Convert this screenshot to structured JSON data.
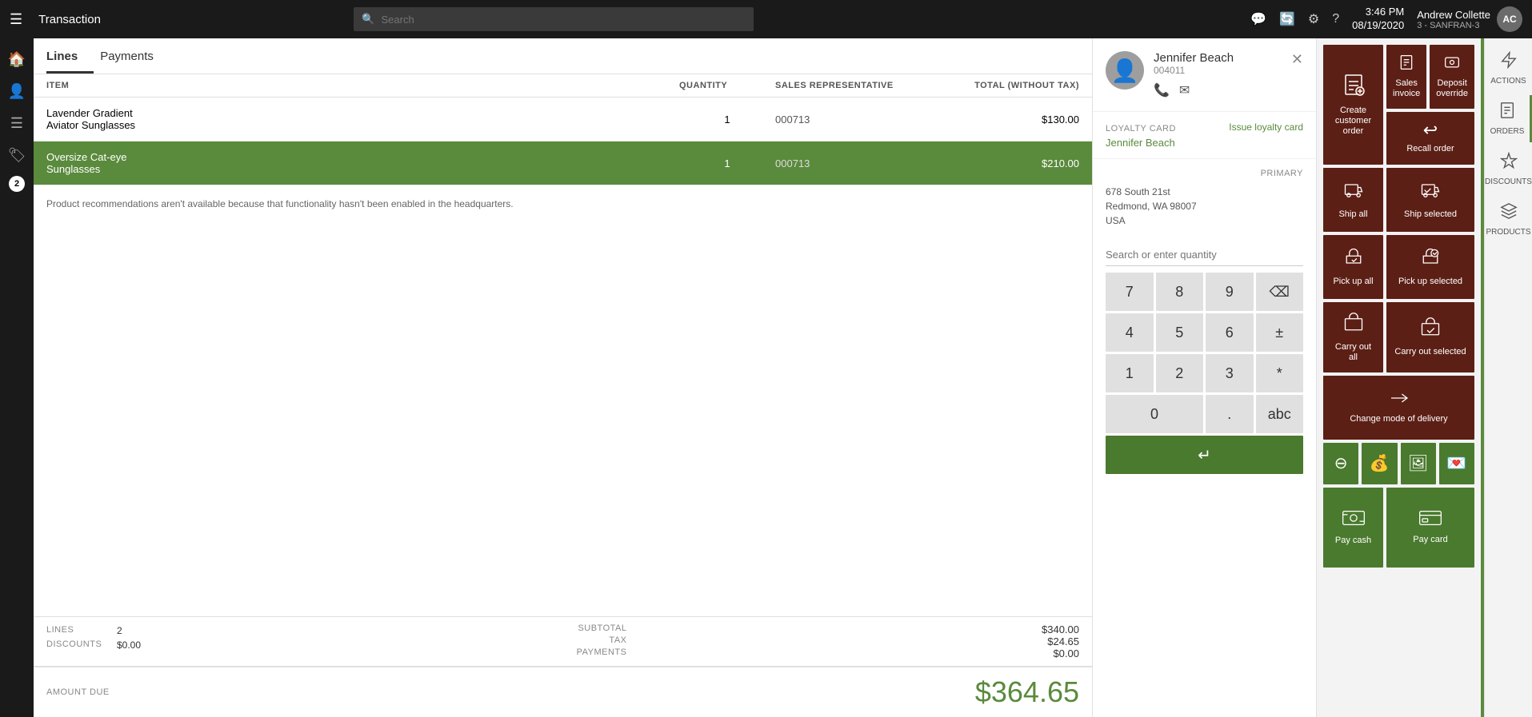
{
  "topbar": {
    "hamburger": "☰",
    "title": "Transaction",
    "search_placeholder": "Search",
    "icons": [
      "💬",
      "🔄",
      "⚙",
      "?"
    ],
    "time": "3:46 PM",
    "date": "08/19/2020",
    "store": "3 - SANFRAN-3",
    "user": "Andrew Collette",
    "avatar": "AC"
  },
  "sidebar": {
    "items": [
      {
        "icon": "🏠",
        "name": "home-icon"
      },
      {
        "icon": "👤",
        "name": "customer-icon"
      },
      {
        "icon": "☰",
        "name": "menu-icon"
      },
      {
        "icon": "🏷",
        "name": "tag-icon"
      },
      {
        "icon": "2",
        "name": "badge-2"
      }
    ]
  },
  "tabs": {
    "items": [
      {
        "label": "Lines",
        "active": true
      },
      {
        "label": "Payments",
        "active": false
      }
    ]
  },
  "table": {
    "headers": [
      "ITEM",
      "QUANTITY",
      "SALES REPRESENTATIVE",
      "TOTAL (WITHOUT TAX)"
    ],
    "rows": [
      {
        "item_name": "Lavender Gradient",
        "item_sub": "Aviator Sunglasses",
        "quantity": "1",
        "rep": "000713",
        "price": "$130.00",
        "selected": false
      },
      {
        "item_name": "Oversize Cat-eye",
        "item_sub": "Sunglasses",
        "quantity": "1",
        "rep": "000713",
        "price": "$210.00",
        "selected": true
      }
    ]
  },
  "notice": "Product recommendations aren't available because that functionality hasn't been enabled in the headquarters.",
  "summary": {
    "lines_label": "LINES",
    "lines_value": "2",
    "discounts_label": "DISCOUNTS",
    "discounts_value": "$0.00",
    "subtotal_label": "SUBTOTAL",
    "subtotal_value": "$340.00",
    "tax_label": "TAX",
    "tax_value": "$24.65",
    "payments_label": "PAYMENTS",
    "payments_value": "$0.00",
    "amount_due_label": "AMOUNT DUE",
    "amount_due_value": "$364.65"
  },
  "customer": {
    "name": "Jennifer Beach",
    "id": "004011",
    "phone_icon": "📞",
    "email_icon": "✉",
    "loyalty_label": "LOYALTY CARD",
    "loyalty_link": "Issue loyalty card",
    "loyalty_name": "Jennifer Beach",
    "address": "678 South 21st\nRedmond, WA 98007\nUSA",
    "primary_label": "PRIMARY"
  },
  "numpad": {
    "search_placeholder": "Search or enter quantity",
    "keys": [
      "7",
      "8",
      "9",
      "⌫",
      "4",
      "5",
      "6",
      "±",
      "1",
      "2",
      "3",
      "*",
      "0",
      ".",
      "abc"
    ],
    "enter_icon": "↵"
  },
  "actions": {
    "tiles": [
      {
        "label": "Create customer order",
        "icon": "📋",
        "color": "dark-red",
        "span": false,
        "name": "create-customer-order"
      },
      {
        "label": "Sales invoice",
        "icon": "🧾",
        "color": "dark-red",
        "span": false,
        "name": "sales-invoice"
      },
      {
        "label": "Deposit override",
        "icon": "💳",
        "color": "dark-red",
        "span": false,
        "name": "deposit-override"
      },
      {
        "label": "Recall order",
        "icon": "↩",
        "color": "dark-red",
        "span": false,
        "name": "recall-order"
      },
      {
        "label": "Ship all",
        "icon": "🚚",
        "color": "dark-red",
        "span": false,
        "name": "ship-all"
      },
      {
        "label": "Ship selected",
        "icon": "📦",
        "color": "dark-red",
        "span": false,
        "name": "ship-selected"
      },
      {
        "label": "Pick up all",
        "icon": "🛒",
        "color": "dark-red",
        "span": false,
        "name": "pick-up-all"
      },
      {
        "label": "Pick up selected",
        "icon": "🛍",
        "color": "dark-red",
        "span": false,
        "name": "pick-up-selected"
      },
      {
        "label": "Carry out all",
        "icon": "🛄",
        "color": "dark-red",
        "span": false,
        "name": "carry-out-all"
      },
      {
        "label": "Carry out selected",
        "icon": "🛄",
        "color": "dark-red",
        "span": false,
        "name": "carry-out-selected"
      },
      {
        "label": "Change mode of delivery",
        "icon": "🔄",
        "color": "dark-red",
        "span": false,
        "name": "change-mode-delivery"
      },
      {
        "label": "Pay cash",
        "icon": "💵",
        "color": "green",
        "span": false,
        "name": "pay-cash"
      },
      {
        "label": "Pay card",
        "icon": "💳",
        "color": "green",
        "span": false,
        "name": "pay-card"
      }
    ],
    "small_tiles": [
      {
        "icon": "⊖",
        "name": "discount-icon-1"
      },
      {
        "icon": "💰",
        "name": "discount-icon-2"
      },
      {
        "icon": "🖼",
        "name": "gift-card-icon"
      },
      {
        "icon": "💌",
        "name": "loyalty-icon"
      }
    ]
  },
  "right_sidebar": {
    "items": [
      {
        "icon": "⚡",
        "label": "ACTIONS",
        "name": "actions-nav"
      },
      {
        "icon": "📋",
        "label": "ORDERS",
        "name": "orders-nav"
      },
      {
        "icon": "🏷",
        "label": "DISCOUNTS",
        "name": "discounts-nav"
      },
      {
        "icon": "📦",
        "label": "PRODUCTS",
        "name": "products-nav"
      }
    ]
  }
}
